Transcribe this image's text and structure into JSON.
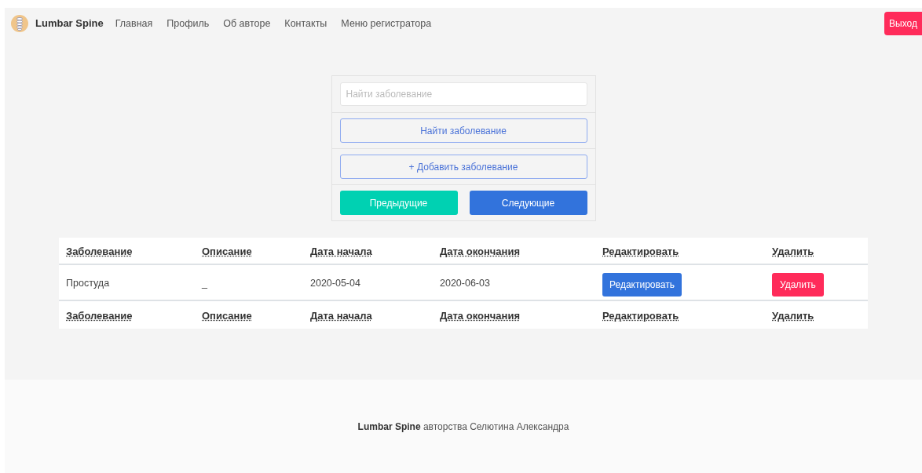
{
  "navbar": {
    "brand": "Lumbar Spine",
    "links": [
      "Главная",
      "Профиль",
      "Об авторе",
      "Контакты",
      "Меню регистратора"
    ],
    "logout": "Выход"
  },
  "search_panel": {
    "placeholder": "Найти заболевание",
    "find_button": "Найти заболевание",
    "add_button": "+ Добавить заболевание",
    "prev_button": "Предыдущие",
    "next_button": "Следующие"
  },
  "table": {
    "columns": [
      "Заболевание",
      "Описание",
      "Дата начала",
      "Дата окончания",
      "Редактировать",
      "Удалить"
    ],
    "rows": [
      {
        "disease": "Простуда",
        "description": "_",
        "start": "2020-05-04",
        "end": "2020-06-03",
        "edit": "Редактировать",
        "delete": "Удалить"
      }
    ],
    "footer_columns": [
      "Заболевание",
      "Описание",
      "Дата начала",
      "Дата окончания",
      "Редактировать",
      "Удалить"
    ]
  },
  "footer": {
    "brand": "Lumbar Spine",
    "text": "авторства Селютина Александра"
  }
}
